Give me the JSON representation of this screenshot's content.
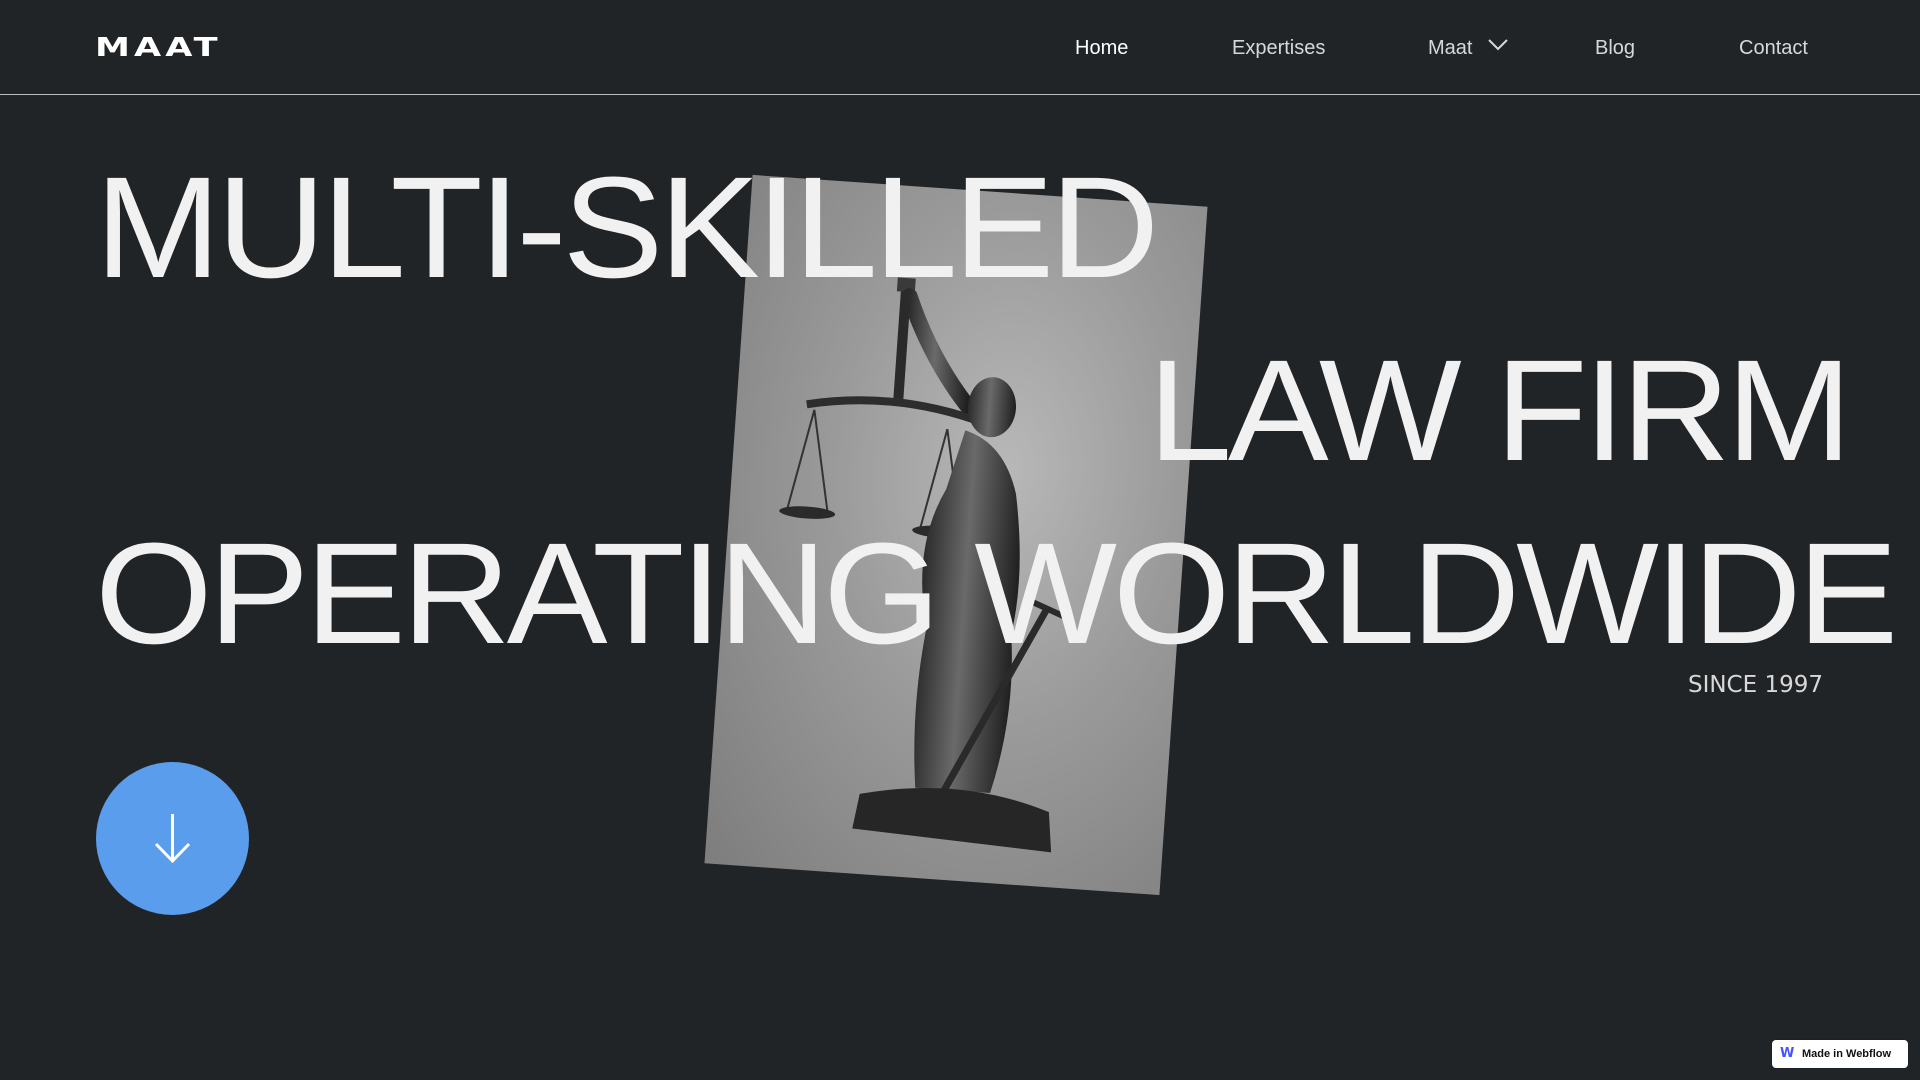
{
  "brand": {
    "logo": "MAAT"
  },
  "nav": {
    "home": "Home",
    "expertises": "Expertises",
    "maat": "Maat",
    "blog": "Blog",
    "contact": "Contact"
  },
  "hero": {
    "line1": "MULTI-SKILLED",
    "line2": "LAW FIRM",
    "line3": "OPERATING WORLDWIDE",
    "since": "SINCE 1997",
    "image_label": "statue of lady justice"
  },
  "badge": {
    "label": "Made in Webflow"
  },
  "colors": {
    "background": "#212427",
    "accent": "#5b9ded",
    "text": "#f1f1f1"
  },
  "icons": {
    "dropdown": "chevron-down-icon",
    "scroll": "arrow-down-icon",
    "badge": "webflow-icon"
  }
}
